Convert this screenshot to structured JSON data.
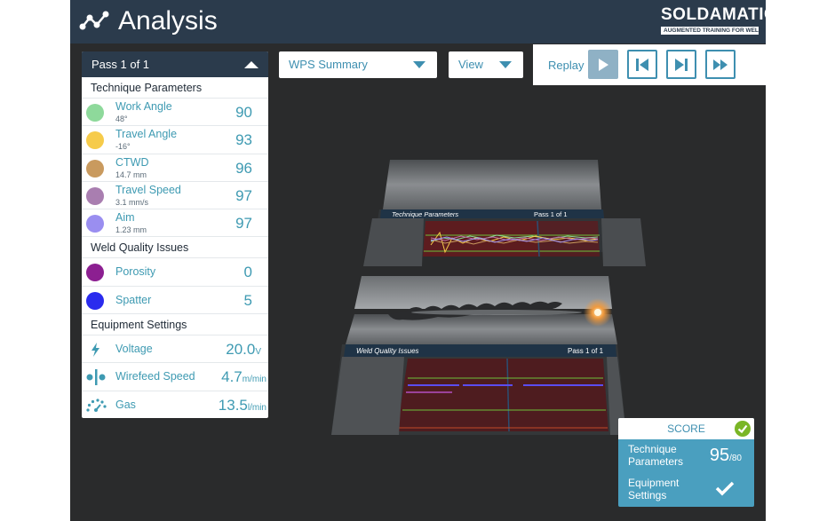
{
  "header": {
    "title": "Analysis",
    "brand_name": "SOLDAMATIC",
    "brand_tagline": "AUGMENTED TRAINING FOR WELDING"
  },
  "panel": {
    "pass_label": "Pass 1 of 1",
    "technique_title": "Technique Parameters",
    "technique": [
      {
        "label": "Work Angle",
        "sub": "48°",
        "value": "90",
        "color": "#8ed99b"
      },
      {
        "label": "Travel Angle",
        "sub": "-16°",
        "value": "93",
        "color": "#f6cb4a"
      },
      {
        "label": "CTWD",
        "sub": "14.7 mm",
        "value": "96",
        "color": "#c99a5e"
      },
      {
        "label": "Travel Speed",
        "sub": "3.1 mm/s",
        "value": "97",
        "color": "#a97eb0"
      },
      {
        "label": "Aim",
        "sub": "1.23 mm",
        "value": "97",
        "color": "#9a8ef0"
      }
    ],
    "quality_title": "Weld Quality Issues",
    "quality": [
      {
        "label": "Porosity",
        "value": "0",
        "color": "#8c1f91"
      },
      {
        "label": "Spatter",
        "value": "5",
        "color": "#2a2bee"
      }
    ],
    "equipment_title": "Equipment Settings",
    "equipment": [
      {
        "label": "Voltage",
        "value": "20.0",
        "unit": "V",
        "icon": "lightning-icon"
      },
      {
        "label": "Wirefeed Speed",
        "value": "4.7",
        "unit": "m/min",
        "icon": "wirefeed-icon"
      },
      {
        "label": "Gas",
        "value": "13.5",
        "unit": "l/min",
        "icon": "gas-gauge-icon"
      }
    ]
  },
  "dropdowns": {
    "summary": "WPS Summary",
    "view": "View"
  },
  "replay": {
    "label": "Replay"
  },
  "scene": {
    "top_panel_label": "Technique Parameters",
    "top_panel_pass": "Pass 1 of 1",
    "bottom_panel_label": "Weld Quality Issues",
    "bottom_panel_pass": "Pass 1 of 1"
  },
  "score": {
    "title": "SCORE",
    "technique_label_1": "Technique",
    "technique_label_2": "Parameters",
    "technique_value": "95",
    "technique_max": "/80",
    "equipment_label_1": "Equipment",
    "equipment_label_2": "Settings"
  }
}
